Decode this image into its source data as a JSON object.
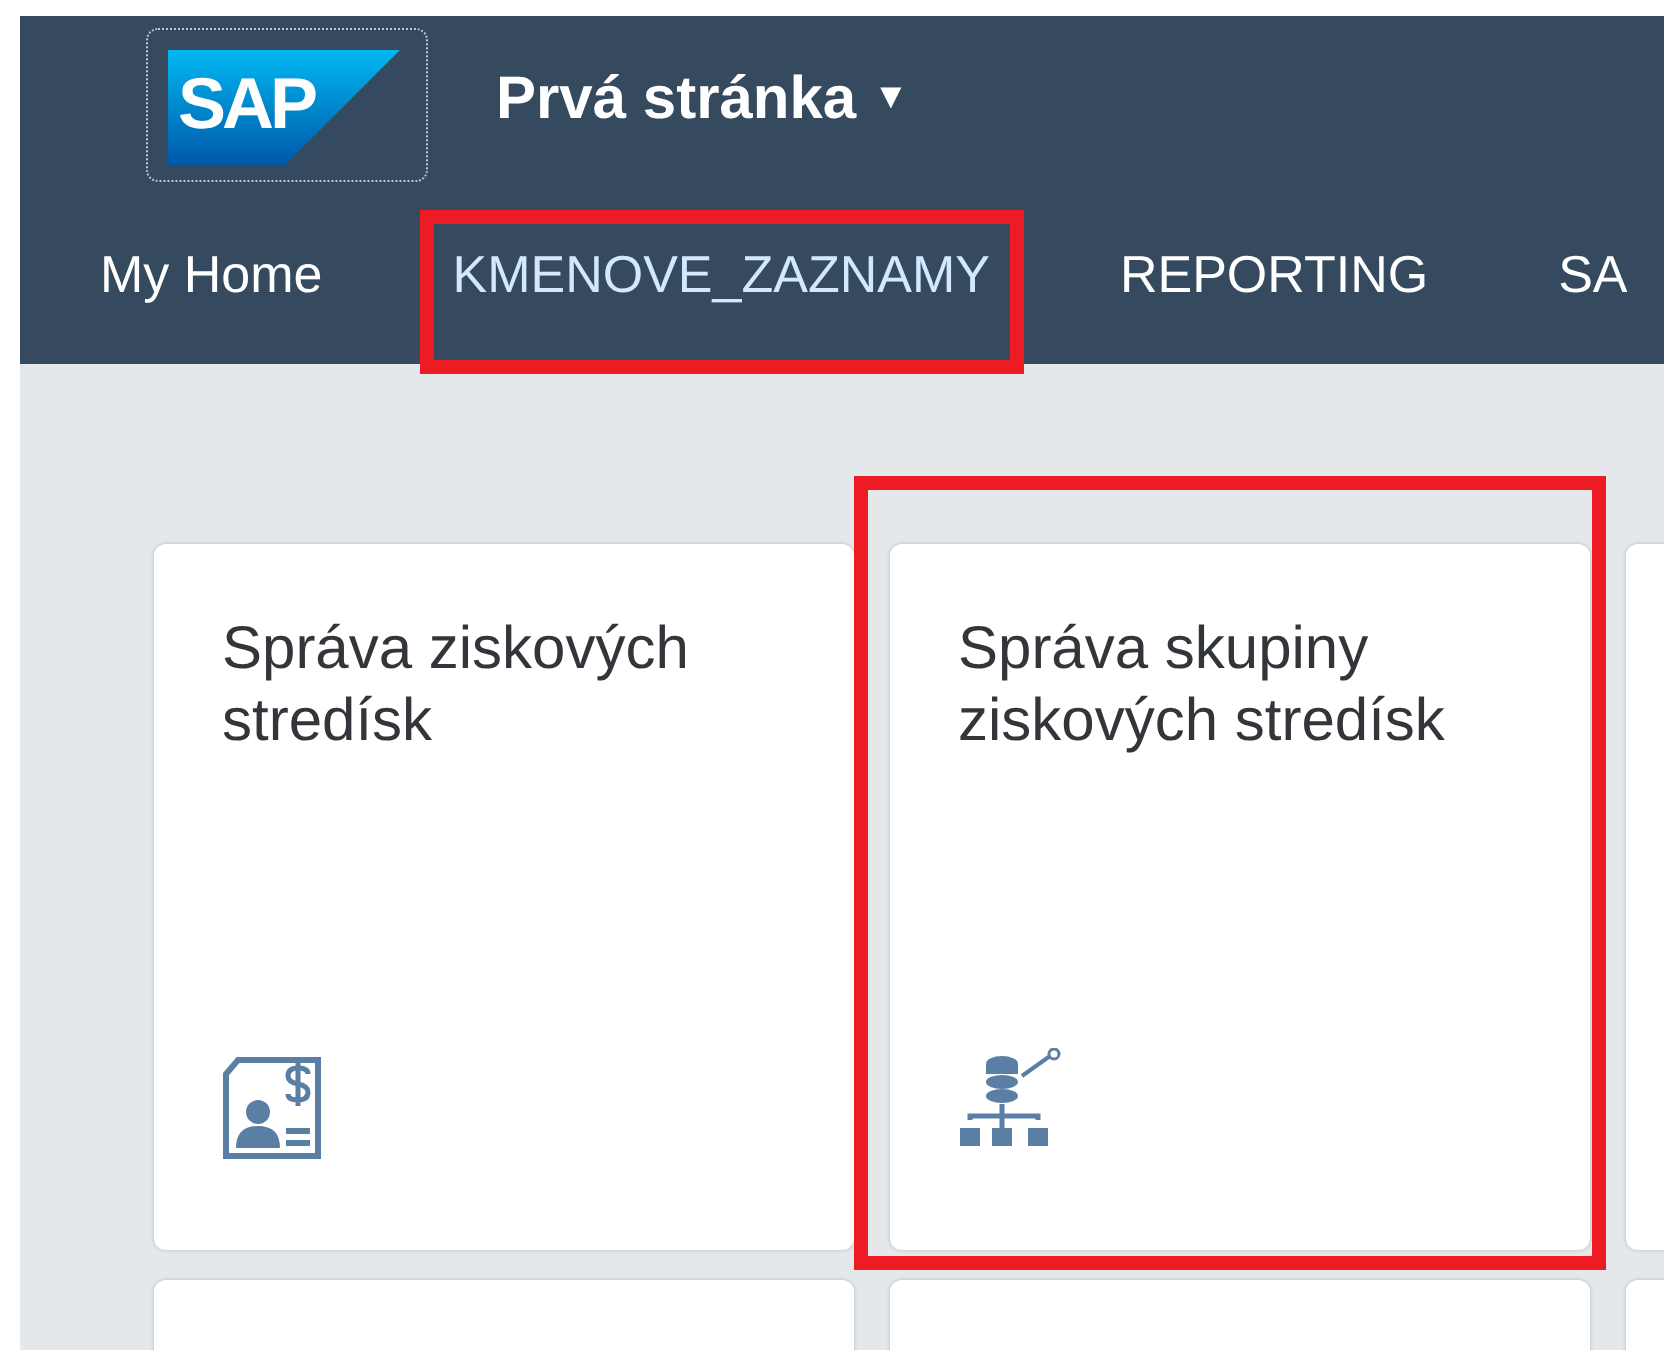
{
  "header": {
    "logo_text": "SAP",
    "title": "Prvá stránka",
    "title_caret": "▼"
  },
  "tabs": [
    {
      "label": "My Home",
      "selected": false,
      "highlighted": false
    },
    {
      "label": "KMENOVE_ZAZNAMY",
      "selected": true,
      "highlighted": true
    },
    {
      "label": "REPORTING",
      "selected": false,
      "highlighted": false
    },
    {
      "label": "SA",
      "selected": false,
      "highlighted": false
    }
  ],
  "tiles": [
    {
      "title": "Správa ziskových stredísk",
      "kind": "person-document",
      "highlighted": false
    },
    {
      "title": "Správa skupiny ziskových stredísk",
      "kind": "hierarchy",
      "highlighted": true
    }
  ]
}
